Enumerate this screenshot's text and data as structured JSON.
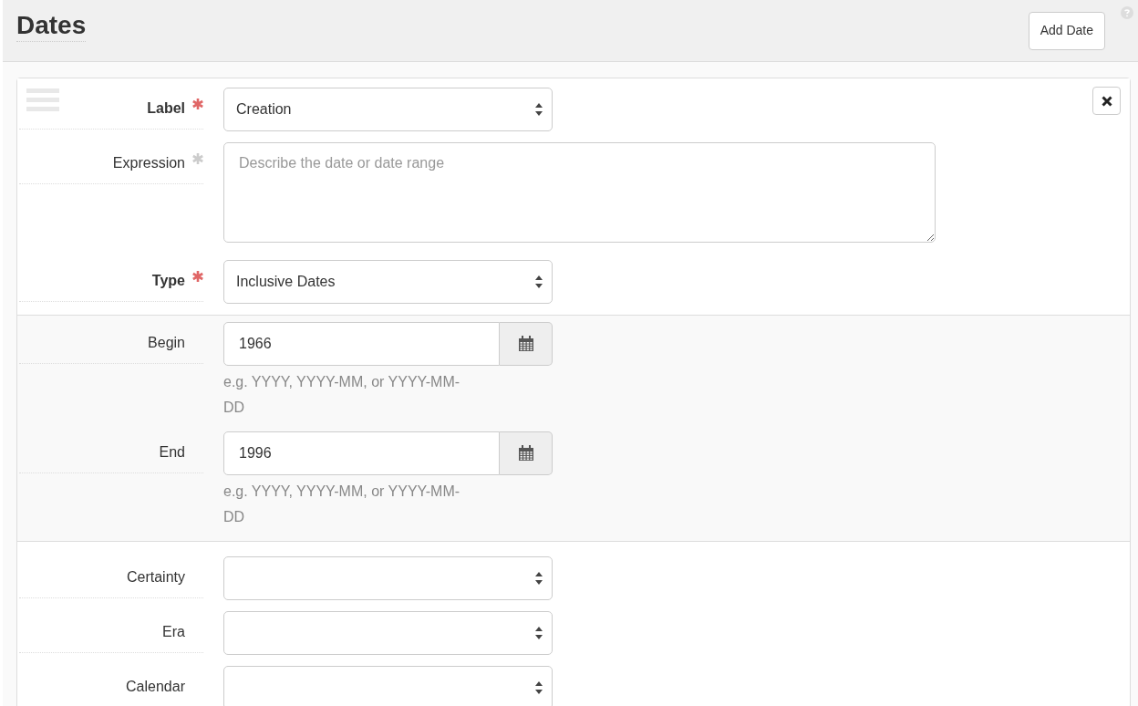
{
  "header": {
    "title": "Dates",
    "add_button": "Add Date"
  },
  "sections": [
    {
      "shaded": false,
      "fields": [
        {
          "kind": "select",
          "label": "Label",
          "asterisk": true,
          "required": true,
          "value": "Creation"
        },
        {
          "kind": "textarea",
          "label": "Expression",
          "asterisk": true,
          "required": false,
          "placeholder": "Describe the date or date range"
        },
        {
          "kind": "select",
          "label": "Type",
          "asterisk": true,
          "required": true,
          "value": "Inclusive Dates"
        }
      ]
    },
    {
      "shaded": true,
      "fields": [
        {
          "kind": "date",
          "label": "Begin",
          "asterisk": false,
          "required": false,
          "value": "1966",
          "help": "e.g. YYYY, YYYY-MM, or YYYY-MM-DD"
        },
        {
          "kind": "date",
          "label": "End",
          "asterisk": false,
          "required": false,
          "value": "1996",
          "help": "e.g. YYYY, YYYY-MM, or YYYY-MM-DD"
        }
      ]
    },
    {
      "shaded": false,
      "fields": [
        {
          "kind": "select",
          "label": "Certainty",
          "asterisk": false,
          "required": false
        },
        {
          "kind": "select",
          "label": "Era",
          "asterisk": false,
          "required": false
        },
        {
          "kind": "select",
          "label": "Calendar",
          "asterisk": false,
          "required": false
        }
      ]
    }
  ]
}
